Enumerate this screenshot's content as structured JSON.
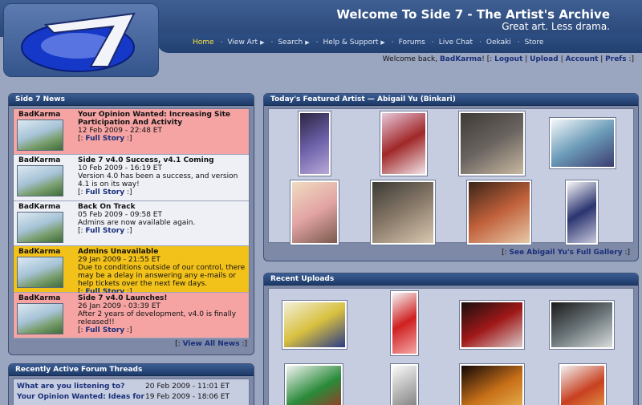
{
  "header": {
    "title": "Welcome To Side 7 - The Artist's Archive",
    "tagline": "Great art. Less drama.",
    "logo_icon": "side7-logo-icon"
  },
  "nav": {
    "items": [
      {
        "label": "Home",
        "active": true,
        "has_arrow": false
      },
      {
        "label": "View Art",
        "active": false,
        "has_arrow": true
      },
      {
        "label": "Search",
        "active": false,
        "has_arrow": true
      },
      {
        "label": "Help & Support",
        "active": false,
        "has_arrow": true
      },
      {
        "label": "Forums",
        "active": false,
        "has_arrow": false
      },
      {
        "label": "Live Chat",
        "active": false,
        "has_arrow": false
      },
      {
        "label": "Oekaki",
        "active": false,
        "has_arrow": false
      },
      {
        "label": "Store",
        "active": false,
        "has_arrow": false
      }
    ]
  },
  "userbar": {
    "welcome": "Welcome back, ",
    "username": "BadKarma",
    "after_name": "! [: ",
    "logout": "Logout",
    "upload": "Upload",
    "account": "Account",
    "prefs": "Prefs",
    "close": " :]"
  },
  "news": {
    "heading": "Side 7 News",
    "items": [
      {
        "author": "BadKarma",
        "title": "Your Opinion Wanted: Increasing Site Participation And Activity",
        "date": "12 Feb 2009 - 22:48 ET",
        "body": "",
        "link": "Full Story",
        "bg": "pink"
      },
      {
        "author": "BadKarma",
        "title": "Side 7 v4.0 Success, v4.1 Coming",
        "date": "10 Feb 2009 - 16:19 ET",
        "body": "Version 4.0 has been a success, and version 4.1 is on its way!",
        "link": "Full Story",
        "bg": "white"
      },
      {
        "author": "BadKarma",
        "title": "Back On Track",
        "date": "05 Feb 2009 - 09:58 ET",
        "body": "Admins are now available again.",
        "link": "Full Story",
        "bg": "white"
      },
      {
        "author": "BadKarma",
        "title": "Admins Unavailable",
        "date": "29 Jan 2009 - 21:55 ET",
        "body": "Due to conditions outside of our control, there may be a delay in answering any e-mails or help tickets over the next few days.",
        "link": "Full Story",
        "bg": "yellow"
      },
      {
        "author": "BadKarma",
        "title": "Side 7 v4.0 Launches!",
        "date": "26 Jan 2009 - 03:39 ET",
        "body": "After 2 years of development, v4.0 is finally released!!",
        "link": "Full Story",
        "bg": "pink"
      }
    ],
    "view_all": "View All News",
    "link_open": "[: ",
    "link_close": " :]"
  },
  "forum": {
    "heading": "Recently Active Forum Threads",
    "threads": [
      {
        "title": "What are you listening to?",
        "date": "20 Feb 2009 - 11:01 ET"
      },
      {
        "title": "Your Opinion Wanted: Ideas for",
        "date": "19 Feb 2009 - 18:06 ET"
      }
    ]
  },
  "featured": {
    "heading": "Today's Featured Artist — Abigail Yu (Binkari)",
    "gallery_link": "See Abigail Yu's Full Gallery",
    "thumbs": [
      {
        "name": "featured-thumb-1",
        "colors": [
          "#2b2540",
          "#6b5fa8",
          "#b8a8d8"
        ]
      },
      {
        "name": "featured-thumb-2",
        "colors": [
          "#e8c8dc",
          "#a02828",
          "#f2e4ea"
        ]
      },
      {
        "name": "featured-thumb-3",
        "colors": [
          "#3e3a36",
          "#6a6460",
          "#c8b8a0"
        ]
      },
      {
        "name": "featured-thumb-4",
        "colors": [
          "#f4f8fa",
          "#6c9cb8",
          "#3b3c70"
        ]
      },
      {
        "name": "featured-thumb-5",
        "colors": [
          "#f0dcc0",
          "#e2a4a4",
          "#7a5a4c"
        ]
      },
      {
        "name": "featured-thumb-6",
        "colors": [
          "#3a3a36",
          "#8a7a6a",
          "#d8c8b0"
        ]
      },
      {
        "name": "featured-thumb-7",
        "colors": [
          "#3a2418",
          "#c0603a",
          "#e8c8a8"
        ]
      },
      {
        "name": "featured-thumb-8",
        "colors": [
          "#f6f6f8",
          "#2a3470",
          "#c8c8dc"
        ]
      }
    ]
  },
  "recent": {
    "heading": "Recent Uploads",
    "thumbs": [
      {
        "name": "recent-thumb-1",
        "colors": [
          "#f2f0d8",
          "#d8c040",
          "#2a3a88"
        ]
      },
      {
        "name": "recent-thumb-2",
        "colors": [
          "#f6f6f6",
          "#d02020",
          "#f4a8a8"
        ]
      },
      {
        "name": "recent-thumb-3",
        "colors": [
          "#181010",
          "#a01818",
          "#d8c8c8"
        ]
      },
      {
        "name": "recent-thumb-4",
        "colors": [
          "#1a1a1a",
          "#6a7478",
          "#d8dcdc"
        ]
      },
      {
        "name": "recent-thumb-5",
        "colors": [
          "#f4f4f4",
          "#2a8a3a",
          "#c02020"
        ]
      },
      {
        "name": "recent-thumb-6",
        "colors": [
          "#fafafa",
          "#b0b0b0",
          "#6a6a6a"
        ]
      },
      {
        "name": "recent-thumb-7",
        "colors": [
          "#100808",
          "#c87018",
          "#f0c060"
        ]
      },
      {
        "name": "recent-thumb-8",
        "colors": [
          "#f2f2f2",
          "#c84020",
          "#e8b050"
        ]
      }
    ]
  }
}
